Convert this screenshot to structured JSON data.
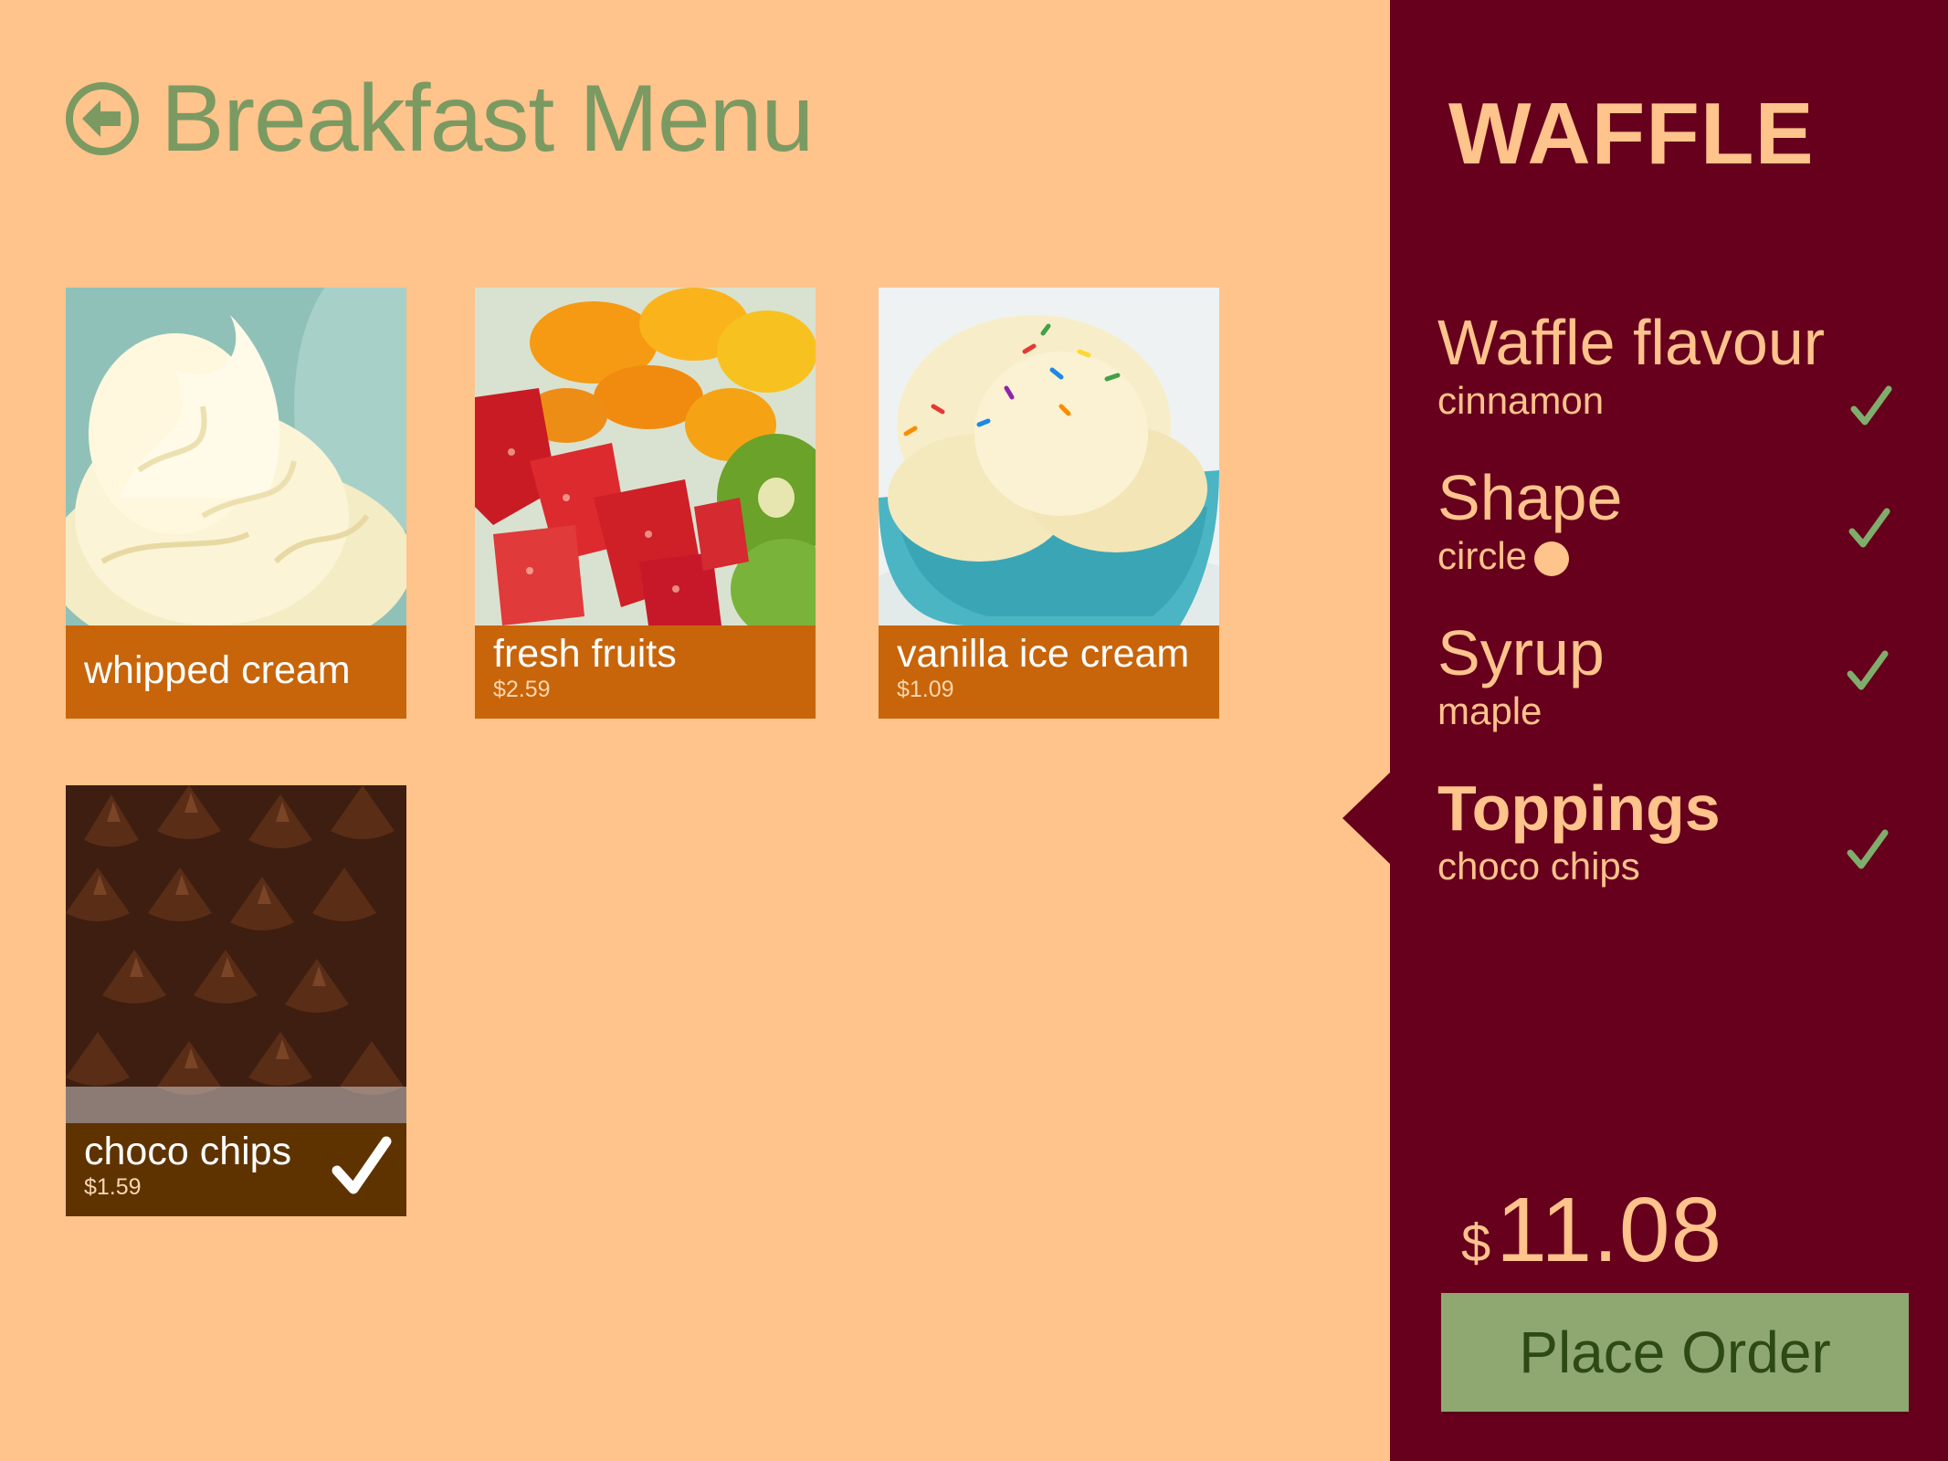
{
  "header": {
    "title": "Breakfast Menu",
    "back_icon": "back-arrow-circle-icon"
  },
  "colors": {
    "background": "#ffc38c",
    "accent_green": "#7a9a62",
    "tile_bar": "#c8650a",
    "tile_bar_selected": "#5f3300",
    "sidebar": "#67001d",
    "button": "#8fa871"
  },
  "toppings": [
    {
      "name": "whipped cream",
      "price": "",
      "selected": false
    },
    {
      "name": "fresh fruits",
      "price": "$2.59",
      "selected": false
    },
    {
      "name": "vanilla ice cream",
      "price": "$1.09",
      "selected": false
    },
    {
      "name": "choco chips",
      "price": "$1.59",
      "selected": true
    }
  ],
  "order": {
    "product": "WAFFLE",
    "options": [
      {
        "label": "Waffle flavour",
        "value": "cinnamon",
        "done": true
      },
      {
        "label": "Shape",
        "value": "circle",
        "done": true
      },
      {
        "label": "Syrup",
        "value": "maple",
        "done": true
      },
      {
        "label": "Toppings",
        "value": "choco chips",
        "done": true,
        "active": true
      }
    ],
    "currency": "$",
    "total": "11.08",
    "place_order_label": "Place Order"
  }
}
